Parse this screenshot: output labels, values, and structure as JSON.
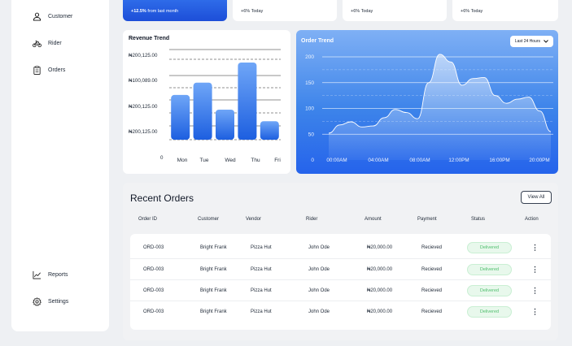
{
  "sidebar": {
    "items": [
      {
        "label": "Customer",
        "icon": "user-icon"
      },
      {
        "label": "Rider",
        "icon": "bike-icon"
      },
      {
        "label": "Orders",
        "icon": "clipboard-icon"
      }
    ],
    "bottom_items": [
      {
        "label": "Reports",
        "icon": "chart-line-icon"
      },
      {
        "label": "Settings",
        "icon": "gear-icon"
      }
    ]
  },
  "stats": [
    {
      "sub_delta": "+12.5%",
      "sub_text": "from last month"
    },
    {
      "sub_text": "+6% Today"
    },
    {
      "sub_text": "+6% Today"
    },
    {
      "sub_text": "+6% Today"
    }
  ],
  "revenue": {
    "title": "Revenue Trend",
    "accent": "#3b82f6"
  },
  "order_trend": {
    "title": "Order Trend",
    "range": "Last 24 Hours"
  },
  "chart_data": [
    {
      "type": "bar",
      "title": "Revenue Trend",
      "categories": [
        "Mon",
        "Tue",
        "Wed",
        "Thu",
        "Fri"
      ],
      "y_tick_labels": [
        "₦200,125.00",
        "₦100,089.00",
        "₦200,125.00",
        "₦200,125.00",
        "0"
      ],
      "values": [
        0.58,
        0.74,
        0.39,
        1.0,
        0.24
      ]
    },
    {
      "type": "area",
      "title": "Order Trend",
      "x_tick_labels": [
        "00:00AM",
        "04:00AM",
        "08:00AM",
        "12:00PM",
        "16:00PM",
        "20:00PM"
      ],
      "y_ticks": [
        0,
        50,
        100,
        150,
        200
      ],
      "ylim": [
        0,
        200
      ],
      "points": [
        [
          0,
          52
        ],
        [
          1,
          68
        ],
        [
          2,
          74
        ],
        [
          3,
          64
        ],
        [
          4,
          66
        ],
        [
          5,
          82
        ],
        [
          6,
          98
        ],
        [
          7,
          92
        ],
        [
          8,
          80
        ],
        [
          9,
          150
        ],
        [
          10,
          205
        ],
        [
          11,
          190
        ],
        [
          12,
          145
        ],
        [
          13,
          158
        ],
        [
          14,
          160
        ],
        [
          15,
          125
        ],
        [
          16,
          110
        ],
        [
          17,
          118
        ],
        [
          18,
          122
        ],
        [
          19,
          95
        ],
        [
          20,
          55
        ]
      ],
      "x_max": 20
    }
  ],
  "orders": {
    "title": "Recent Orders",
    "view_all": "View All",
    "columns": [
      "Order ID",
      "Customer",
      "Vendor",
      "Rider",
      "Amount",
      "Payment",
      "Status",
      "Action"
    ],
    "rows": [
      {
        "id": "ORD-003",
        "customer": "Bright Frank",
        "vendor": "Pizza Hut",
        "rider": "John Ode",
        "amount": "₦20,000.00",
        "payment": "Recieved",
        "status": "Delivered"
      },
      {
        "id": "ORD-003",
        "customer": "Bright Frank",
        "vendor": "Pizza Hut",
        "rider": "John Ode",
        "amount": "₦20,000.00",
        "payment": "Recieved",
        "status": "Delivered"
      },
      {
        "id": "ORD-003",
        "customer": "Bright Frank",
        "vendor": "Pizza Hut",
        "rider": "John Ode",
        "amount": "₦20,000.00",
        "payment": "Recieved",
        "status": "Delivered"
      },
      {
        "id": "ORD-003",
        "customer": "Bright Frank",
        "vendor": "Pizza Hut",
        "rider": "John Ode",
        "amount": "₦20,000.00",
        "payment": "Recieved",
        "status": "Delivered"
      }
    ]
  }
}
